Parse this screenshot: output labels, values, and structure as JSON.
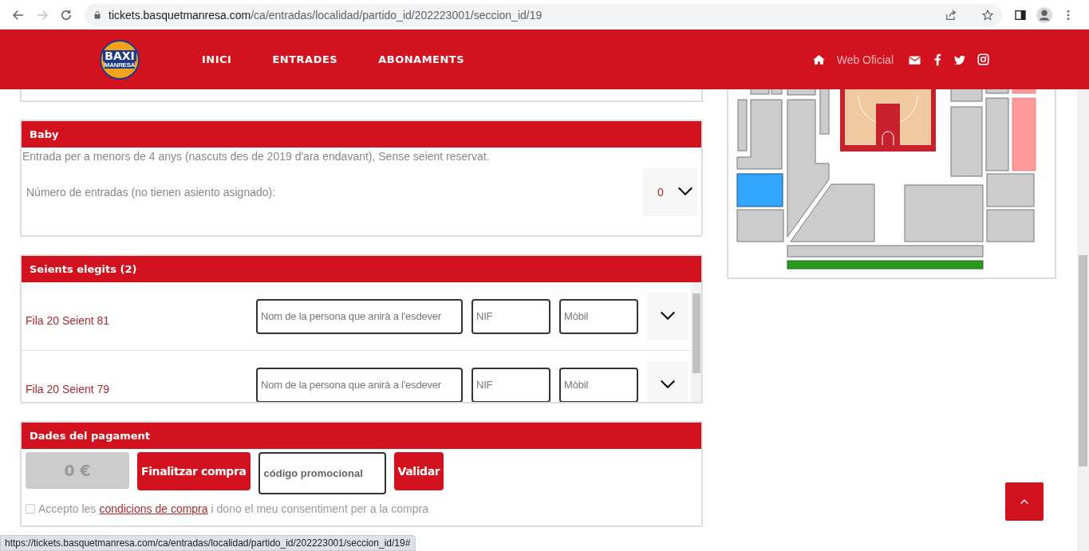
{
  "browser": {
    "url_host": "tickets.basquetmanresa.com",
    "url_path": "/ca/entradas/localidad/partido_id/202223001/seccion_id/19"
  },
  "header": {
    "logo_text": "BAXI",
    "logo_subtext": "MANRESA",
    "nav": [
      "INICI",
      "ENTRADES",
      "ABONAMENTS"
    ],
    "web_oficial": "Web Oficial"
  },
  "baby": {
    "title": "Baby",
    "description": "Entrada per a menors de 4 anys (nascuts des de 2019 d'ara endavant), Sense seient reservat.",
    "quantity_label": "Número de entradas (no tienen asiento asignado):",
    "quantity": "0"
  },
  "seats": {
    "title": "Seients elegits (2)",
    "rows": [
      {
        "label": "Fila 20 Seient 81",
        "name_placeholder": "Nom de la persona que anirà a l'esdever",
        "nif_placeholder": "NIF",
        "mobile_placeholder": "Mòbil"
      },
      {
        "label": "Fila 20 Seient 79",
        "name_placeholder": "Nom de la persona que anirà a l'esdever",
        "nif_placeholder": "NIF",
        "mobile_placeholder": "Mòbil"
      }
    ]
  },
  "payment": {
    "title": "Dades del pagament",
    "total": "0 €",
    "finish_button": "Finalitzar compra",
    "promo_placeholder": "código promocional",
    "validate_button": "Validar",
    "terms": {
      "checked": false,
      "before": "Accepto les",
      "link": "condicions de compra",
      "after": "i dono el meu consentiment per a la compra"
    }
  },
  "status_url": "https://tickets.basquetmanresa.com/ca/entradas/localidad/partido_id/202223001/seccion_id/19#"
}
